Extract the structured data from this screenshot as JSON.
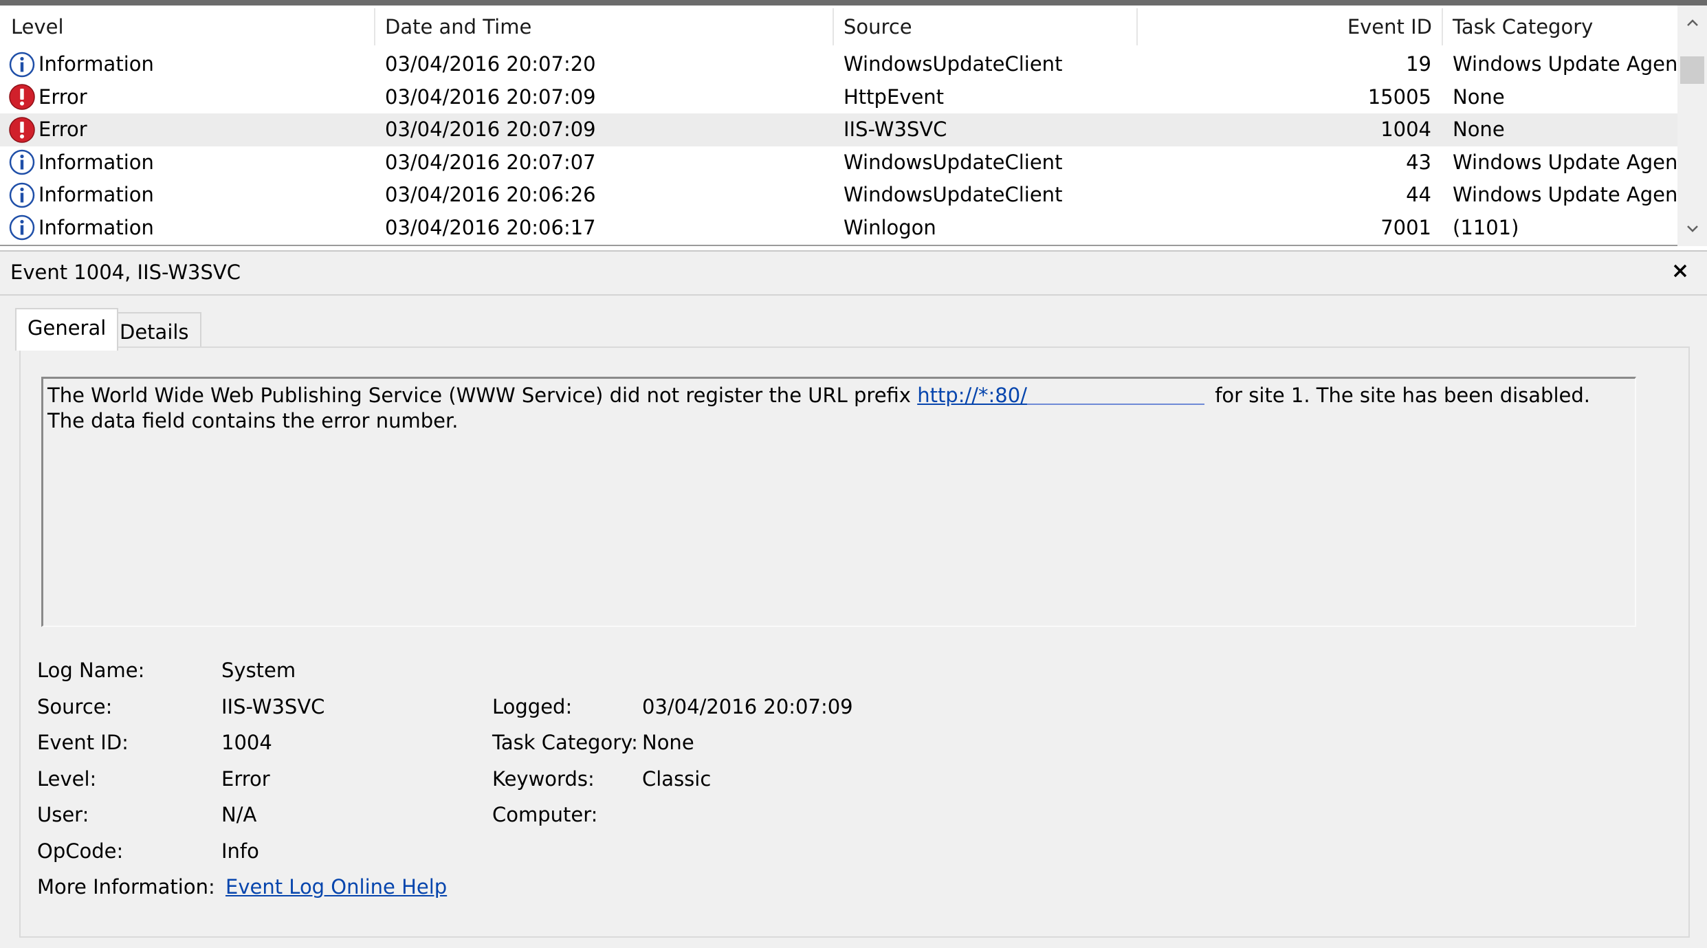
{
  "columns": {
    "level": "Level",
    "datetime": "Date and Time",
    "source": "Source",
    "event_id": "Event ID",
    "task_category": "Task Category"
  },
  "rows": [
    {
      "icon": "information-icon",
      "level": "Information",
      "datetime": "03/04/2016 20:07:20",
      "source": "WindowsUpdateClient",
      "event_id": "19",
      "task_category": "Windows Update Agent"
    },
    {
      "icon": "error-icon",
      "level": "Error",
      "datetime": "03/04/2016 20:07:09",
      "source": "HttpEvent",
      "event_id": "15005",
      "task_category": "None"
    },
    {
      "icon": "error-icon",
      "level": "Error",
      "datetime": "03/04/2016 20:07:09",
      "source": "IIS-W3SVC",
      "event_id": "1004",
      "task_category": "None"
    },
    {
      "icon": "information-icon",
      "level": "Information",
      "datetime": "03/04/2016 20:07:07",
      "source": "WindowsUpdateClient",
      "event_id": "43",
      "task_category": "Windows Update Agent"
    },
    {
      "icon": "information-icon",
      "level": "Information",
      "datetime": "03/04/2016 20:06:26",
      "source": "WindowsUpdateClient",
      "event_id": "44",
      "task_category": "Windows Update Agent"
    },
    {
      "icon": "information-icon",
      "level": "Information",
      "datetime": "03/04/2016 20:06:17",
      "source": "Winlogon",
      "event_id": "7001",
      "task_category": "(1101)"
    }
  ],
  "details": {
    "title": "Event 1004, IIS-W3SVC",
    "tabs": [
      "General",
      "Details"
    ],
    "message": {
      "before": "The World Wide Web Publishing Service (WWW Service) did not register the URL prefix ",
      "link": "http://*:80/",
      "after": " for site 1. The site has been disabled. The data field contains the error number."
    },
    "fields": {
      "log_name_label": "Log Name:",
      "log_name": "System",
      "source_label": "Source:",
      "source": "IIS-W3SVC",
      "logged_label": "Logged:",
      "logged": "03/04/2016 20:07:09",
      "event_id_label": "Event ID:",
      "event_id": "1004",
      "task_category_label": "Task Category:",
      "task_category": "None",
      "level_label": "Level:",
      "level": "Error",
      "keywords_label": "Keywords:",
      "keywords": "Classic",
      "user_label": "User:",
      "user": "N/A",
      "computer_label": "Computer:",
      "opcode_label": "OpCode:",
      "opcode": "Info",
      "more_info_label": "More Information:",
      "more_info_link": "Event Log Online Help"
    }
  },
  "colors": {
    "error_red": "#d0202b",
    "info_blue": "#1f4fa8",
    "link_blue": "#0645ad",
    "selected_row": "#ececec",
    "pane_bg": "#f0f0f0"
  }
}
